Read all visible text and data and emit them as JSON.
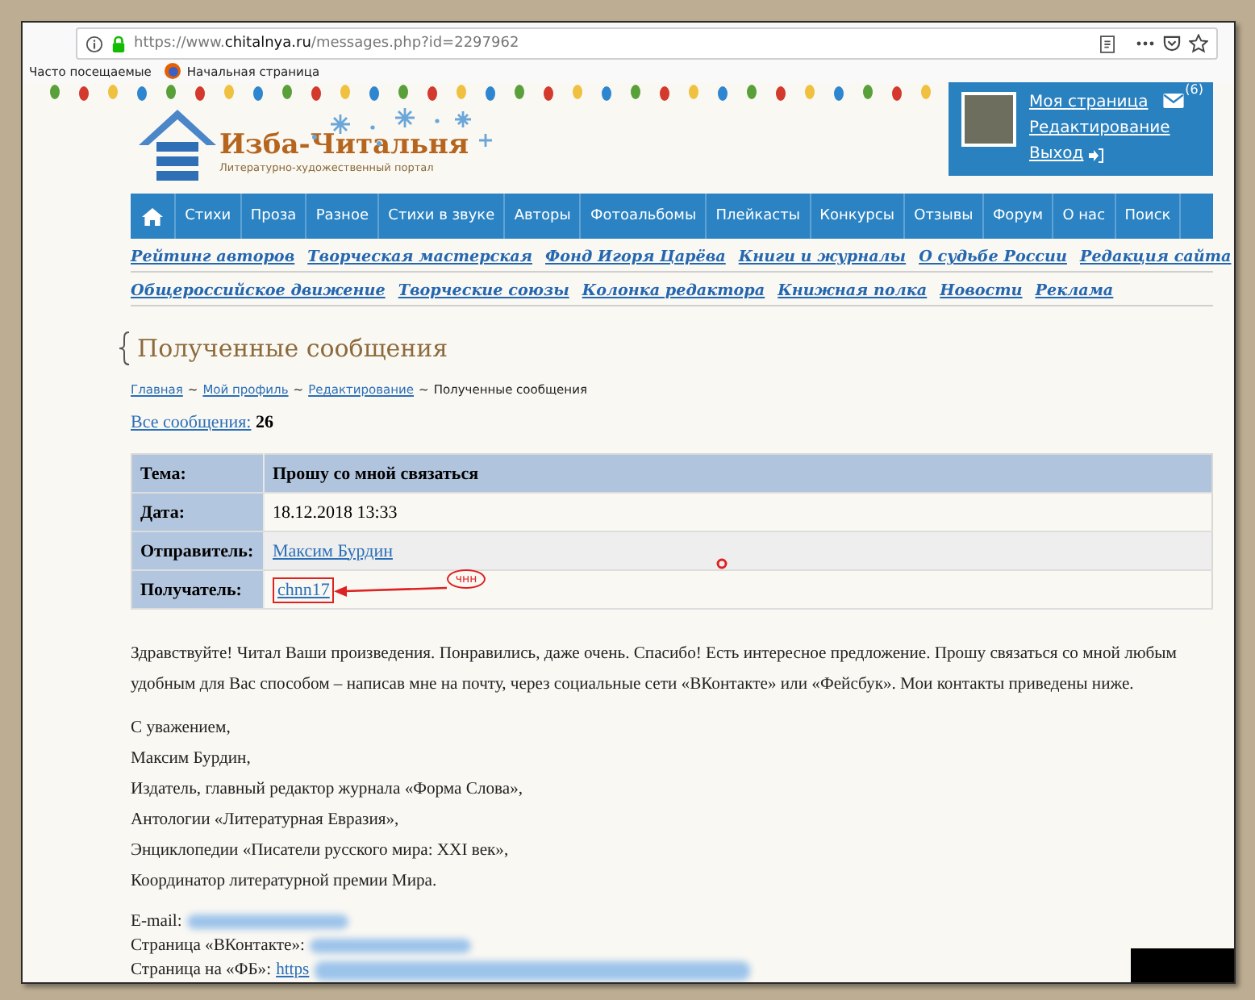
{
  "browser": {
    "url_scheme": "https://www.",
    "url_domain": "chitalnya.ru",
    "url_path": "/messages.php?id=2297962"
  },
  "bookmarks": [
    {
      "label": "Часто посещаемые",
      "kind": "plain"
    },
    {
      "label": "Начальная страница",
      "kind": "browser"
    }
  ],
  "logo": {
    "name": "Изба-Читальня",
    "tagline": "Литературно-художественный портал"
  },
  "user_menu": {
    "links": [
      "Моя страница",
      "Редактирование",
      "Выход"
    ],
    "message_count": "(6)"
  },
  "nav": [
    "Стихи",
    "Проза",
    "Разное",
    "Стихи в звуке",
    "Авторы",
    "Фотоальбомы",
    "Плейкасты",
    "Конкурсы",
    "Отзывы",
    "Форум",
    "О нас",
    "Поиск"
  ],
  "sub_links": [
    [
      "Рейтинг авторов",
      "Творческая мастерская",
      "Фонд Игоря Царёва",
      "Книги и журналы",
      "О судьбе России",
      "Редакция сайта"
    ],
    [
      "Общероссийское движение",
      "Творческие союзы",
      "Колонка редактора",
      "Книжная полка",
      "Новости",
      "Реклама"
    ]
  ],
  "page_title": "Полученные сообщения",
  "breadcrumbs": [
    {
      "label": "Главная",
      "link": true
    },
    {
      "label": "Мой профиль",
      "link": true
    },
    {
      "label": "Редактирование",
      "link": true
    },
    {
      "label": "Полученные сообщения",
      "link": false
    }
  ],
  "breadcrumb_separator": "~",
  "all_messages": {
    "label": "Все сообщения:",
    "count": "26"
  },
  "message": [
    {
      "label": "Тема:",
      "value": "Прошу со мной связаться",
      "kind": "heading"
    },
    {
      "label": "Дата:",
      "value": "18.12.2018 13:33",
      "kind": "text"
    },
    {
      "label": "Отправитель:",
      "value": "Максим Бурдин",
      "kind": "link"
    },
    {
      "label": "Получатель:",
      "value": "chnn17",
      "kind": "annotated-link"
    }
  ],
  "annotation": {
    "note": "чнн"
  },
  "body": "Здравствуйте! Читал Ваши произведения. Понравились, даже очень. Спасибо! Есть интересное предложение. Прошу связаться со мной любым удобным для Вас способом – написав мне на почту, через социальные сети «ВКонтакте» или «Фейсбук». Мои контакты приведены ниже.",
  "signature": [
    "С уважением,",
    "Максим Бурдин,",
    "Издатель, главный редактор журнала «Форма Слова»,",
    "Антологии «Литературная Евразия»,",
    "Энциклопедии «Писатели русского мира: XXI век»,",
    "Координатор литературной премии Мира."
  ],
  "contacts": [
    {
      "label": "E-mail:",
      "kind": "blurred"
    },
    {
      "label": "Страница «ВКонтакте»:",
      "kind": "blurred"
    },
    {
      "label": "Страница на «ФБ»:",
      "value": "https",
      "kind": "partly-blurred"
    }
  ]
}
